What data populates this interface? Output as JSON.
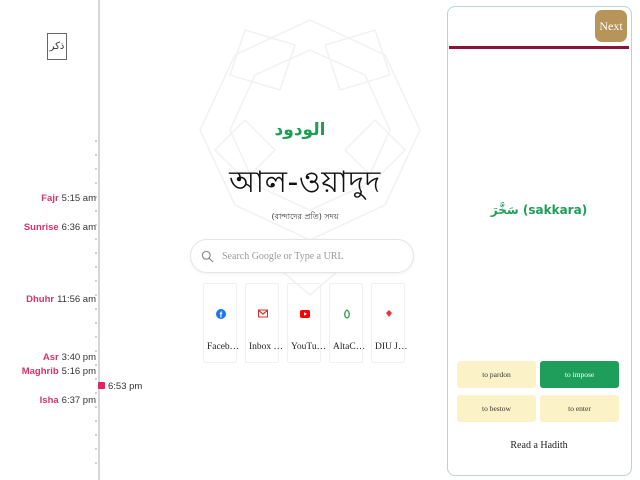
{
  "logo": {
    "text": "ذکر"
  },
  "prayers": [
    {
      "name": "Fajr",
      "time": "5:15 am"
    },
    {
      "name": "Sunrise",
      "time": "6:36 am"
    },
    {
      "name": "Dhuhr",
      "time": "11:56 am"
    },
    {
      "name": "Asr",
      "time": "3:40 pm"
    },
    {
      "name": "Maghrib",
      "time": "5:16 pm"
    },
    {
      "name": "Isha",
      "time": "6:37 pm"
    }
  ],
  "current_time": "6:53 pm",
  "colors": {
    "prayer_name": "#d6336c",
    "accent_green": "#1e9e55",
    "next_button": "#b7945a",
    "panel_bar": "#8b1538",
    "option_bg": "#fbf3c7",
    "option_correct": "#1e9e5a"
  },
  "name_of_allah": {
    "arabic": "الودود",
    "bengali": "আল-ওয়াদুদ",
    "meaning": "(বান্দাদের প্রতি) সদয়"
  },
  "search": {
    "placeholder": "Search Google or Type a URL",
    "icon": "search-icon"
  },
  "shortcuts": [
    {
      "label": "Faceb…",
      "icon": "facebook-icon",
      "color": "#1877f2"
    },
    {
      "label": "Inbox …",
      "icon": "gmail-icon",
      "color": "#d93025"
    },
    {
      "label": "YouTu…",
      "icon": "youtube-icon",
      "color": "#ff0000"
    },
    {
      "label": "AltaC…",
      "icon": "altacademy-icon",
      "color": "#2e9e4f"
    },
    {
      "label": "DIU J…",
      "icon": "diu-icon",
      "color": "#e53935"
    }
  ],
  "quiz": {
    "next_label": "Next",
    "word": "سَخَّرَ (sakkara)",
    "options": [
      {
        "label": "to pardon",
        "correct": false
      },
      {
        "label": "to impose",
        "correct": true
      },
      {
        "label": "to bestow",
        "correct": false
      },
      {
        "label": "to enter",
        "correct": false
      }
    ],
    "hadith_link": "Read a Hadith"
  }
}
